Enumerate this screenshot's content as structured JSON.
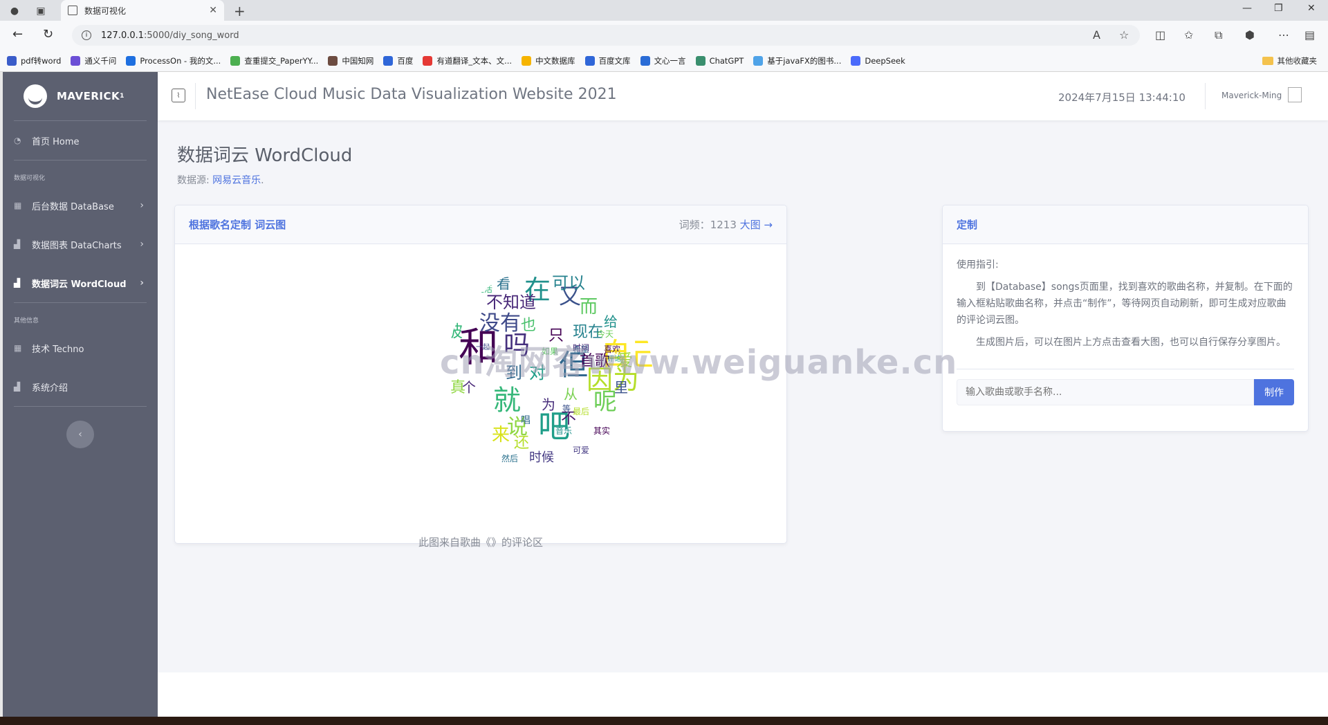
{
  "browser": {
    "tab_title": "数据可视化",
    "url_host": "127.0.0.1",
    "url_path": ":5000/diy_song_word",
    "bookmarks": [
      {
        "label": "pdf转word",
        "color": "#3a5cc9"
      },
      {
        "label": "通义千问",
        "color": "#6b4fd6"
      },
      {
        "label": "ProcessOn - 我的文...",
        "color": "#1e6fe0"
      },
      {
        "label": "查重提交_PaperYY...",
        "color": "#4caf50"
      },
      {
        "label": "中国知网",
        "color": "#6d4c41"
      },
      {
        "label": "百度",
        "color": "#2f66d8"
      },
      {
        "label": "有道翻译_文本、文...",
        "color": "#e53935"
      },
      {
        "label": "中文数据库",
        "color": "#f6b400"
      },
      {
        "label": "百度文库",
        "color": "#2f66d8"
      },
      {
        "label": "文心一言",
        "color": "#2a6cd6"
      },
      {
        "label": "ChatGPT",
        "color": "#3a8f6e"
      },
      {
        "label": "基于javaFX的图书...",
        "color": "#4fa3e8"
      },
      {
        "label": "DeepSeek",
        "color": "#4b6bfb"
      }
    ],
    "other_bookmarks": "其他收藏夹"
  },
  "sidebar": {
    "brand": "MAVERICK",
    "brand_sup": "1",
    "home": "首页 Home",
    "section1": "数据可视化",
    "items": [
      {
        "label": "后台数据 DataBase"
      },
      {
        "label": "数据图表 DataCharts"
      },
      {
        "label": "数据词云 WordCloud"
      }
    ],
    "section2": "其他信息",
    "items2": [
      {
        "label": "技术 Techno"
      },
      {
        "label": "系统介绍"
      }
    ]
  },
  "topbar": {
    "title": "NetEase Cloud Music Data Visualization Website 2021",
    "datetime": "2024年7月15日 13:44:10",
    "user": "Maverick-Ming"
  },
  "page": {
    "title": "数据词云 WordCloud",
    "source_prefix": "数据源: ",
    "source_link": "网易云音乐",
    "source_suffix": "."
  },
  "cloud_card": {
    "title": "根据歌名定制 词云图",
    "freq_prefix": "词频：",
    "freq_value": "1213",
    "big_link": "大图 →",
    "caption": "此图来自歌曲《》的评论区"
  },
  "wordcloud_words": [
    {
      "t": "和",
      "c": "#440154"
    },
    {
      "t": "吗",
      "c": "#46317e"
    },
    {
      "t": "就",
      "c": "#35b779"
    },
    {
      "t": "在",
      "c": "#21918c"
    },
    {
      "t": "又",
      "c": "#3b528b"
    },
    {
      "t": "自己",
      "c": "#fde725"
    },
    {
      "t": "但",
      "c": "#31688e"
    },
    {
      "t": "因为",
      "c": "#b5de2b"
    },
    {
      "t": "吧",
      "c": "#1f9e89"
    },
    {
      "t": "没有",
      "c": "#3e4989"
    },
    {
      "t": "不知道",
      "c": "#482878"
    },
    {
      "t": "可以",
      "c": "#26828e"
    },
    {
      "t": "说",
      "c": "#90d743"
    },
    {
      "t": "呢",
      "c": "#6ece58"
    },
    {
      "t": "首歌",
      "c": "#440154"
    },
    {
      "t": "而",
      "c": "#5ec962"
    },
    {
      "t": "到",
      "c": "#31688e"
    },
    {
      "t": "对",
      "c": "#1f9e89"
    },
    {
      "t": "爱",
      "c": "#a0da39"
    },
    {
      "t": "来",
      "c": "#d8e219"
    },
    {
      "t": "还",
      "c": "#b5de2b"
    },
    {
      "t": "被",
      "c": "#35b779"
    },
    {
      "t": "个",
      "c": "#482878"
    },
    {
      "t": "里",
      "c": "#3b528b"
    },
    {
      "t": "只",
      "c": "#440154"
    },
    {
      "t": "看",
      "c": "#2c728e"
    },
    {
      "t": "也",
      "c": "#4ac16d"
    },
    {
      "t": "时候",
      "c": "#443983"
    },
    {
      "t": "给",
      "c": "#21918c"
    },
    {
      "t": "真",
      "c": "#90d743"
    },
    {
      "t": "现在",
      "c": "#26828e"
    },
    {
      "t": "为",
      "c": "#472d7b"
    },
    {
      "t": "从",
      "c": "#7ad151"
    },
    {
      "t": "不",
      "c": "#481a6c"
    },
    {
      "t": "生活",
      "c": "#35b779"
    },
    {
      "t": "如果",
      "c": "#5ec962"
    },
    {
      "t": "希望",
      "c": "#31688e"
    },
    {
      "t": "音乐",
      "c": "#21918c"
    },
    {
      "t": "其实",
      "c": "#440154"
    },
    {
      "t": "一起",
      "c": "#3e4989"
    },
    {
      "t": "时间",
      "c": "#482878"
    },
    {
      "t": "今天",
      "c": "#6ece58"
    },
    {
      "t": "可爱",
      "c": "#443983"
    },
    {
      "t": "唱",
      "c": "#31688e"
    },
    {
      "t": "等",
      "c": "#3b528b"
    },
    {
      "t": "最后",
      "c": "#b5de2b"
    },
    {
      "t": "然后",
      "c": "#2c728e"
    },
    {
      "t": "喜欢",
      "c": "#440154"
    },
    {
      "t": "好",
      "c": "#fde725"
    },
    {
      "t": "评论",
      "c": "#1f9e89"
    }
  ],
  "custom_card": {
    "title": "定制",
    "guide_title": "使用指引:",
    "guide_p1": "到【Database】songs页面里，找到喜欢的歌曲名称，并复制。在下面的输入框粘贴歌曲名称，并点击“制作”，等待网页自动刷新，即可生成对应歌曲的评论词云图。",
    "guide_p2": "生成图片后，可以在图片上方点击查看大图，也可以自行保存分享图片。",
    "input_placeholder": "输入歌曲或歌手名称...",
    "button": "制作"
  },
  "watermark": "cn淘网客www.weiguanke.cn"
}
